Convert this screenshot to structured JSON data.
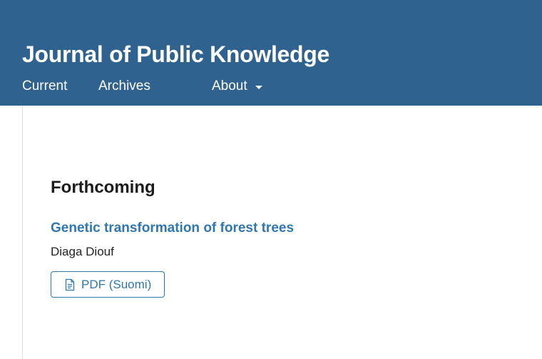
{
  "header": {
    "site_title": "Journal of Public Knowledge",
    "background_color": "#2f628e",
    "nav": {
      "current": "Current",
      "archives": "Archives",
      "about": "About",
      "about_icon": "caret-down-icon"
    }
  },
  "main": {
    "section_heading": "Forthcoming",
    "article": {
      "title": "Genetic transformation of forest trees",
      "author": "Diaga Diouf",
      "galley": {
        "label": "PDF (Suomi)",
        "icon": "file-text-icon"
      }
    },
    "link_color": "#2f77ae"
  }
}
